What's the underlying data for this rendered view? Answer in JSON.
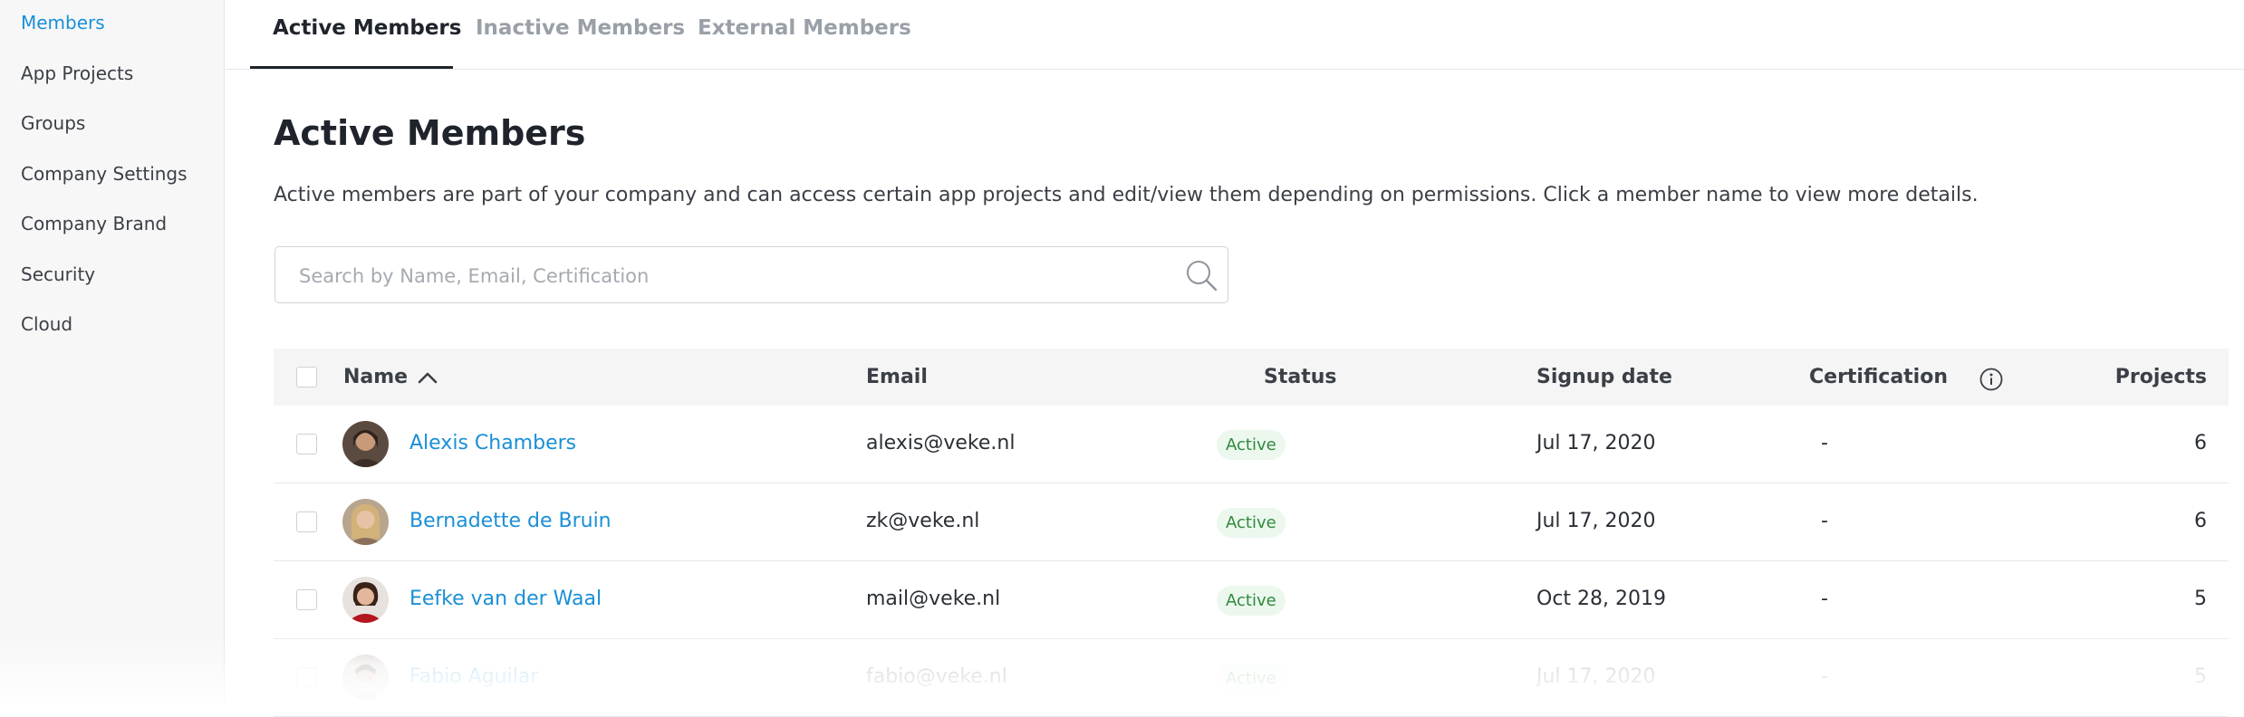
{
  "sidebar": {
    "items": [
      {
        "label": "Members",
        "active": true
      },
      {
        "label": "App Projects"
      },
      {
        "label": "Groups"
      },
      {
        "label": "Company Settings"
      },
      {
        "label": "Company Brand"
      },
      {
        "label": "Security"
      },
      {
        "label": "Cloud"
      }
    ]
  },
  "tabs": [
    {
      "label": "Active Members",
      "active": true
    },
    {
      "label": "Inactive Members"
    },
    {
      "label": "External Members"
    }
  ],
  "page": {
    "title": "Active Members",
    "description": "Active members are part of your company and can access certain app projects and edit/view them depending on permissions. Click a member name to view more details."
  },
  "search": {
    "placeholder": "Search by Name, Email, Certification",
    "value": ""
  },
  "table": {
    "columns": {
      "name": "Name",
      "email": "Email",
      "status": "Status",
      "signup": "Signup date",
      "certification": "Certification",
      "projects": "Projects"
    },
    "sort": {
      "column": "name",
      "direction": "ascending",
      "icon": "chevron-up-icon"
    },
    "rows": [
      {
        "name": "Alexis Chambers",
        "email": "alexis@veke.nl",
        "status": "Active",
        "signup": "Jul 17, 2020",
        "certification": "-",
        "projects": "6"
      },
      {
        "name": "Bernadette de Bruin",
        "email": "zk@veke.nl",
        "status": "Active",
        "signup": "Jul 17, 2020",
        "certification": "-",
        "projects": "6"
      },
      {
        "name": "Eefke van der Waal",
        "email": "mail@veke.nl",
        "status": "Active",
        "signup": "Oct 28, 2019",
        "certification": "-",
        "projects": "5"
      },
      {
        "name": "Fabio Aguilar",
        "email": "fabio@veke.nl",
        "status": "Active",
        "signup": "Jul 17, 2020",
        "certification": "-",
        "projects": "5"
      }
    ]
  },
  "colors": {
    "accent": "#1a8fd6",
    "status_bg": "#ecf7ee",
    "status_text": "#2f8a3d",
    "heading": "#1f242c"
  }
}
